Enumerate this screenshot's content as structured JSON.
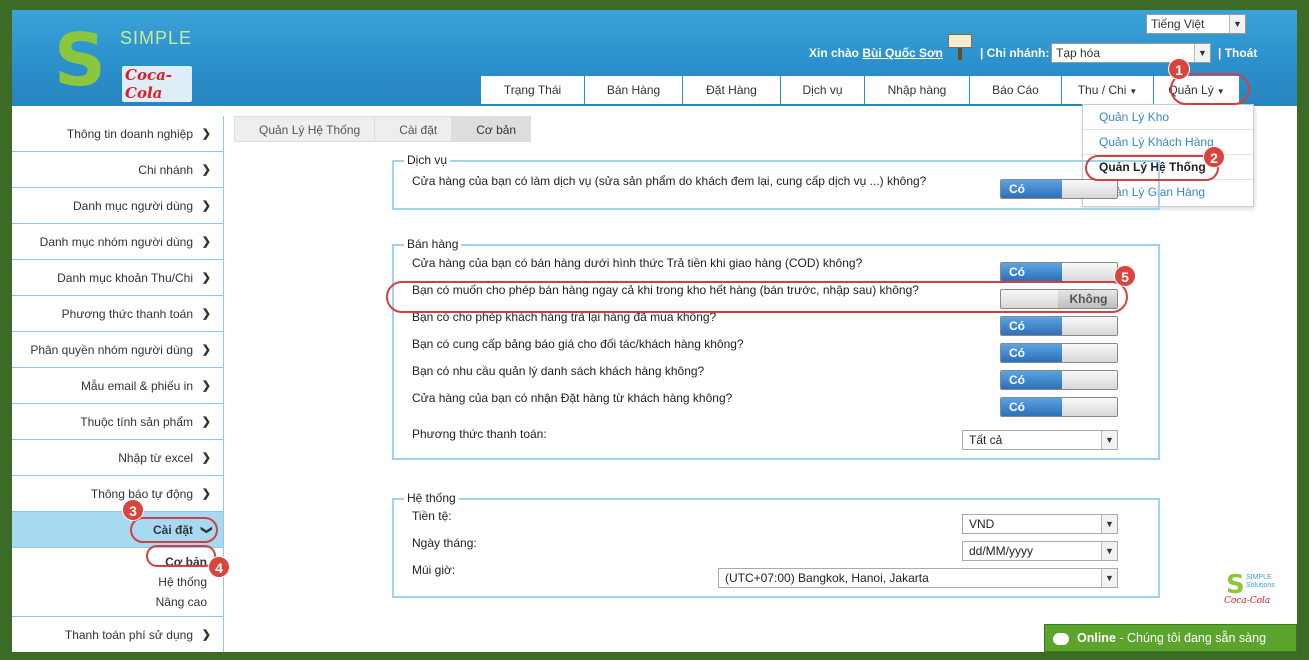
{
  "header": {
    "logo_text": "SIMPLE",
    "logo_brand": "Coca-Cola",
    "language": "Tiếng Việt",
    "greeting_prefix": "Xin chào",
    "user_name": "Bùi Quốc Sơn",
    "branch_label": "| Chi nhánh:",
    "branch_value": "Tạp hóa",
    "logout": "| Thoát"
  },
  "nav": {
    "items": [
      "Trạng Thái",
      "Bán Hàng",
      "Đặt Hàng",
      "Dịch vụ",
      "Nhập hàng",
      "Báo Cáo",
      "Thu / Chi",
      "Quản Lý"
    ]
  },
  "menu": {
    "items": [
      "Quản Lý Kho",
      "Quản Lý Khách Hàng",
      "Quản Lý Hệ Thống",
      "Quản Lý Gian Hàng"
    ]
  },
  "sidebar": {
    "items": [
      "Thông tin doanh nghiệp",
      "Chi nhánh",
      "Danh mục người dùng",
      "Danh mục nhóm người dùng",
      "Danh mục khoản Thu/Chi",
      "Phương thức thanh toán",
      "Phân quyền nhóm người dùng",
      "Mẫu email & phiếu in",
      "Thuộc tính sản phẩm",
      "Nhập từ excel",
      "Thông báo tự động",
      "Cài đặt"
    ],
    "sub_items": [
      "Cơ bản",
      "Hệ thống",
      "Nâng cao"
    ],
    "last_item": "Thanh toán phí sử dụng"
  },
  "breadcrumb": [
    "Quản Lý Hệ Thống",
    "Cài đặt",
    "Cơ bản"
  ],
  "dich_vu": {
    "legend": "Dịch vụ",
    "q1": "Cửa hàng của bạn có làm dịch vụ (sửa sản phẩm do khách đem lại, cung cấp dịch vụ ...) không?",
    "q1_value": "Có"
  },
  "ban_hang": {
    "legend": "Bán hàng",
    "questions": [
      {
        "text": "Cửa hàng của bạn có bán hàng dưới hình thức Trả tiền khi giao hàng (COD) không?",
        "value": "Có"
      },
      {
        "text": "Bạn có muốn cho phép bán hàng ngay cả khi trong kho hết hàng (bán trước, nhập sau) không?",
        "value": "Không"
      },
      {
        "text": "Bạn có cho phép khách hàng trả lại hàng đã mua không?",
        "value": "Có"
      },
      {
        "text": "Bạn có cung cấp bảng báo giá cho đối tác/khách hàng không?",
        "value": "Có"
      },
      {
        "text": "Bạn có nhu cầu quản lý danh sách khách hàng không?",
        "value": "Có"
      },
      {
        "text": "Cửa hàng của bạn có nhận Đặt hàng từ khách hàng không?",
        "value": "Có"
      }
    ],
    "payment_label": "Phương thức thanh toán:",
    "payment_value": "Tất cả"
  },
  "he_thong": {
    "legend": "Hệ thống",
    "currency_label": "Tiền tệ:",
    "currency_value": "VND",
    "date_label": "Ngày tháng:",
    "date_value": "dd/MM/yyyy",
    "tz_label": "Múi giờ:",
    "tz_value": "(UTC+07:00) Bangkok, Hanoi, Jakarta"
  },
  "badges": [
    "1",
    "2",
    "3",
    "4",
    "5"
  ],
  "chat": {
    "status": "Online",
    "message": "- Chúng tôi đang sẵn sàng"
  },
  "colors": {
    "header_blue": "#2a8fcb",
    "toggle_blue": "#2e6fb8",
    "callout_red": "#d2403f",
    "chat_green": "#5ba52c"
  }
}
